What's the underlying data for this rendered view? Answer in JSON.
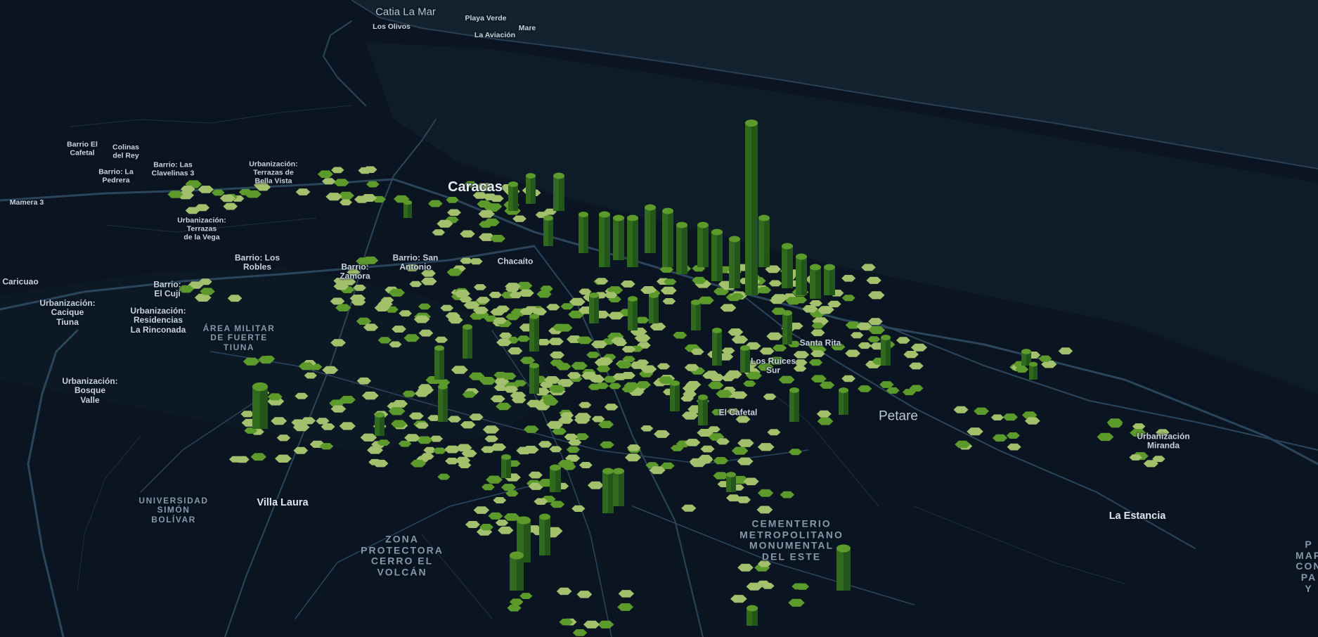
{
  "map": {
    "style": "dark",
    "colors": {
      "land": "#0b1522",
      "sea": "#13222f",
      "road": "#2a4155",
      "hex_light": "#a3c06d",
      "hex_mid": "#5d9a2c",
      "column_dark": "#2f6a1d"
    },
    "labels": [
      {
        "id": "catia-la-mar",
        "text": "Catia La Mar",
        "kind": "place"
      },
      {
        "id": "playa-verde",
        "text": "Playa Verde",
        "kind": "small"
      },
      {
        "id": "los-olivos",
        "text": "Los Olivos",
        "kind": "small"
      },
      {
        "id": "mare",
        "text": "Mare",
        "kind": "small"
      },
      {
        "id": "la-aviacion",
        "text": "La Aviación",
        "kind": "small"
      },
      {
        "id": "barrio-el-cafetal",
        "text": "Barrio El\nCafetal",
        "kind": "small"
      },
      {
        "id": "colinas-del-rey",
        "text": "Colinas\ndel Rey",
        "kind": "small"
      },
      {
        "id": "barrio-la-pedrera",
        "text": "Barrio: La\nPedrera",
        "kind": "small"
      },
      {
        "id": "barrio-las-clavelinas",
        "text": "Barrio: Las\nClavelinas 3",
        "kind": "small"
      },
      {
        "id": "urb-terrazas-bella-vista",
        "text": "Urbanización:\nTerrazas de\nBella Vista",
        "kind": "small"
      },
      {
        "id": "mamera-3",
        "text": "Mamera 3",
        "kind": "small"
      },
      {
        "id": "caracas",
        "text": "Caracas",
        "kind": "city"
      },
      {
        "id": "urb-terrazas-vega",
        "text": "Urbanización:\nTerrazas\nde la Vega",
        "kind": "small"
      },
      {
        "id": "barrio-los-robles",
        "text": "Barrio: Los\nRobles",
        "kind": "small"
      },
      {
        "id": "barrio-zamora",
        "text": "Barrio:\nZamora",
        "kind": "small"
      },
      {
        "id": "barrio-san-antonio",
        "text": "Barrio: San\nAntonio",
        "kind": "small"
      },
      {
        "id": "chacaito",
        "text": "Chacaíto",
        "kind": "small"
      },
      {
        "id": "caricuao",
        "text": "Caricuao",
        "kind": "small"
      },
      {
        "id": "barrio-el-cuji",
        "text": "Barrio:\nEl Cují",
        "kind": "small"
      },
      {
        "id": "urb-cacique-tiuna",
        "text": "Urbanización:\nCacique\nTiuna",
        "kind": "small"
      },
      {
        "id": "urb-residencias-rinconada",
        "text": "Urbanización:\nResidencias\nLa Rinconada",
        "kind": "small"
      },
      {
        "id": "area-militar",
        "text": "ÁREA MILITAR\nDE FUERTE\nTIUNA",
        "kind": "area"
      },
      {
        "id": "urb-bosque-valle",
        "text": "Urbanización:\nBosque\nValle",
        "kind": "small"
      },
      {
        "id": "santa-rita",
        "text": "Santa Rita",
        "kind": "small"
      },
      {
        "id": "los-ruices-sur",
        "text": "Los Ruices\nSur",
        "kind": "small"
      },
      {
        "id": "el-cafetal",
        "text": "El Cafetal",
        "kind": "small"
      },
      {
        "id": "petare",
        "text": "Petare",
        "kind": "place"
      },
      {
        "id": "urb-miranda",
        "text": "Urbanización\nMiranda",
        "kind": "small"
      },
      {
        "id": "universidad-simon-bolivar",
        "text": "UNIVERSIDAD\nSIMÓN\nBOLÍVAR",
        "kind": "area"
      },
      {
        "id": "villa-laura",
        "text": "Villa Laura",
        "kind": "town"
      },
      {
        "id": "zona-protectora",
        "text": "ZONA\nPROTECTORA\nCERRO EL\nVOLCÁN",
        "kind": "area"
      },
      {
        "id": "cementerio",
        "text": "CEMENTERIO\nMETROPOLITANO\nMONUMENTAL\nDEL ESTE",
        "kind": "area"
      },
      {
        "id": "la-estancia",
        "text": "La Estancia",
        "kind": "town"
      },
      {
        "id": "parque-marques",
        "text": "P\nMAR\nCON\nPA\nY",
        "kind": "area"
      }
    ]
  }
}
